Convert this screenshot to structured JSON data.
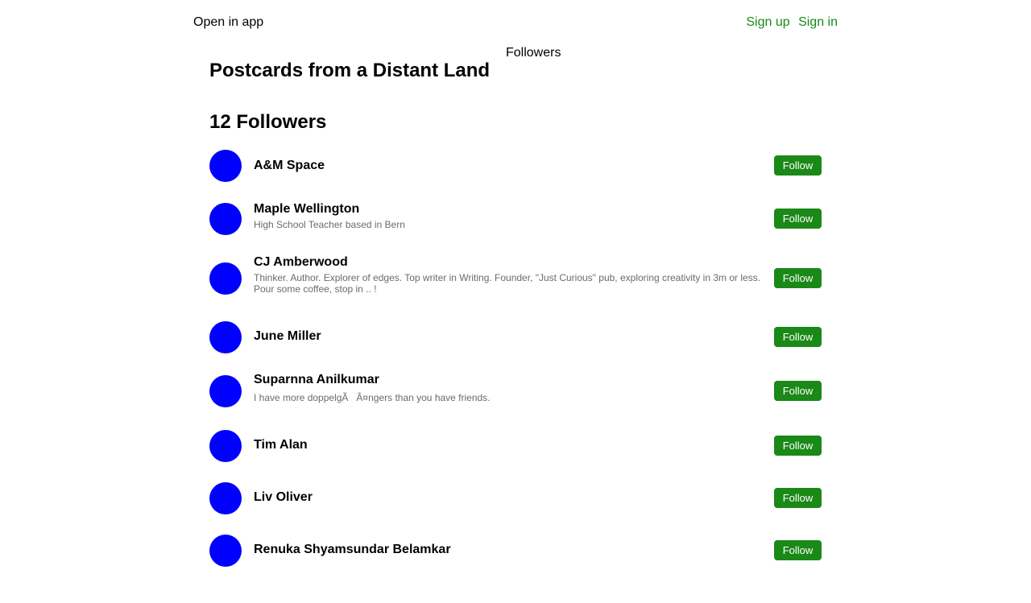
{
  "header": {
    "open_in_app": "Open in app",
    "sign_up": "Sign up",
    "sign_in": "Sign in",
    "followers_tab": "Followers",
    "link_color": "#1a8917"
  },
  "publication": {
    "title": "Postcards from a Distant Land",
    "followers_heading": "12 Followers"
  },
  "followers": [
    {
      "name": "A&M Space",
      "bio": "",
      "button": "Follow"
    },
    {
      "name": "Maple Wellington",
      "bio": "High School Teacher based in Bern",
      "button": "Follow"
    },
    {
      "name": "CJ Amberwood",
      "bio": "Thinker. Author. Explorer of edges. Top writer in Writing. Founder, \"Just Curious\" pub, exploring creativity in 3m or less. Pour some coffee, stop in .. !",
      "button": "Follow"
    },
    {
      "name": "June Miller",
      "bio": "",
      "button": "Follow"
    },
    {
      "name": "Suparnna Anilkumar",
      "bio": "I have more doppelgÃ   Â¤ngers than you have friends.",
      "button": "Follow"
    },
    {
      "name": "Tim Alan",
      "bio": "",
      "button": "Follow"
    },
    {
      "name": "Liv Oliver",
      "bio": "",
      "button": "Follow"
    },
    {
      "name": "Renuka Shyamsundar Belamkar",
      "bio": "",
      "button": "Follow"
    }
  ],
  "colors": {
    "avatar": "#0000ff",
    "button_bg": "#1a8917",
    "button_text": "#ffffff",
    "bio_text": "#6b6b6b"
  }
}
